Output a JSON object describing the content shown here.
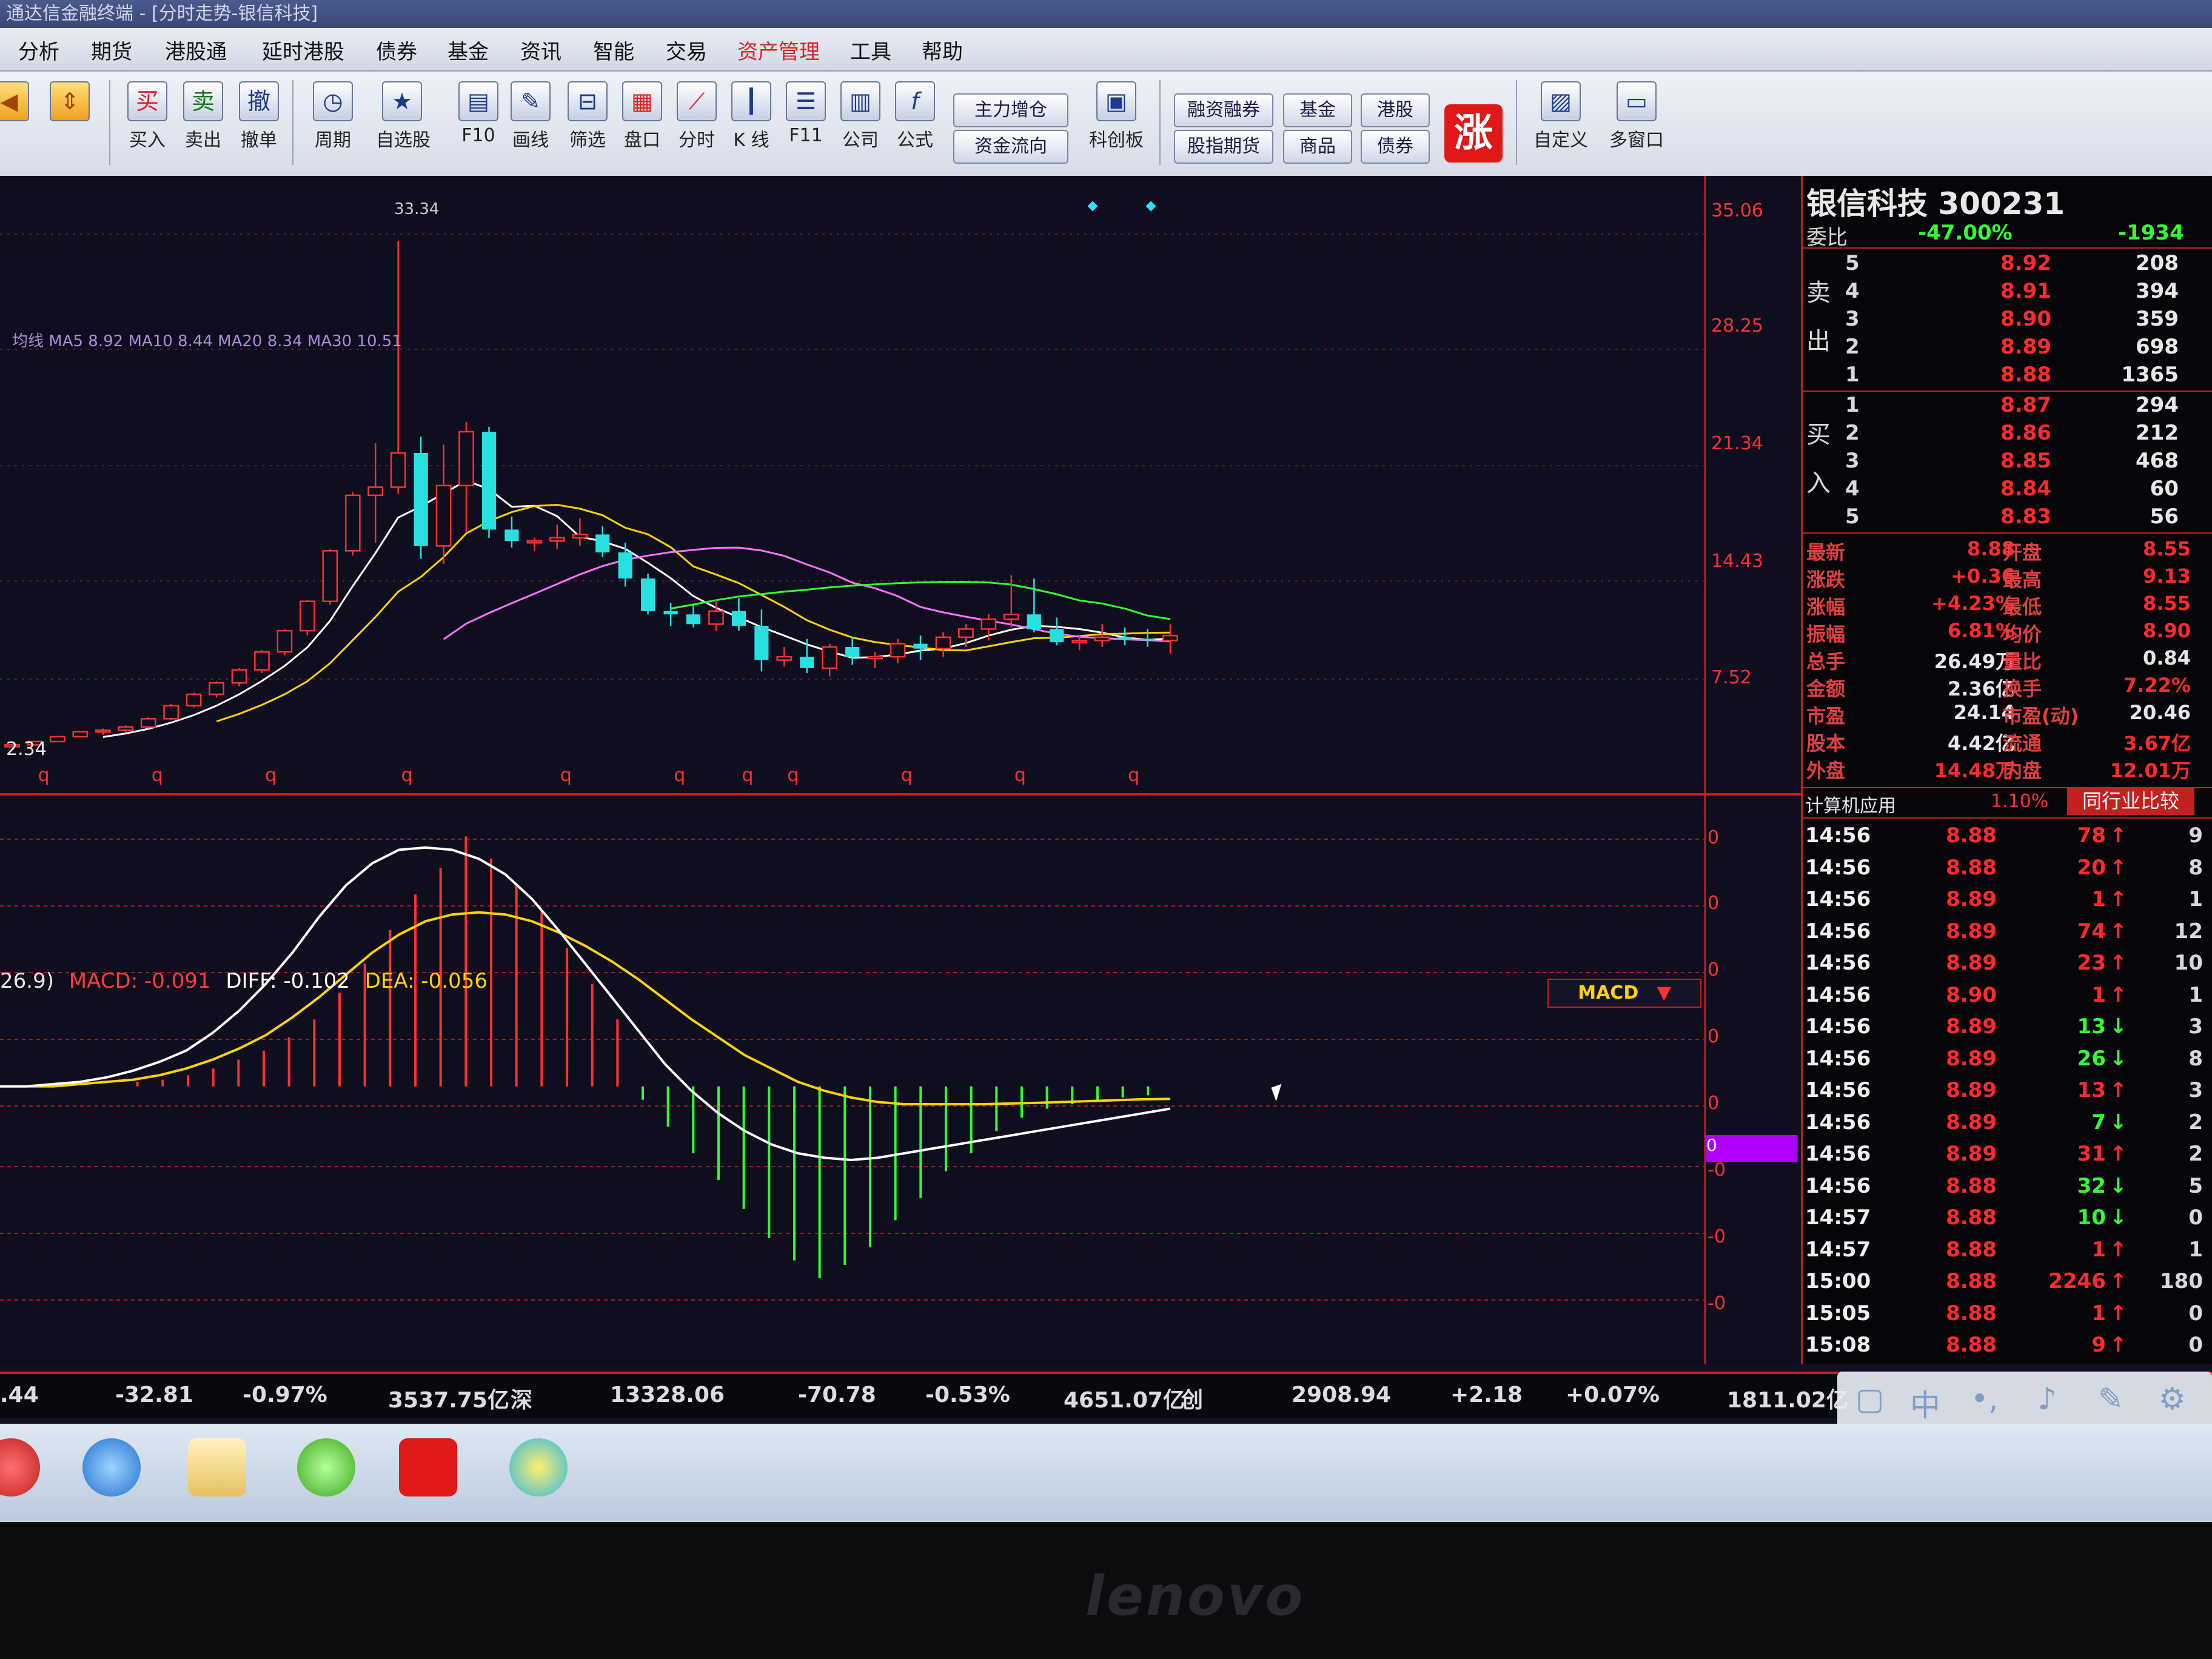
{
  "window": {
    "title": "通达信金融终端 - [分时走势-银信科技]",
    "menu": [
      "分析",
      "期货",
      "港股通",
      "延时港股",
      "债券",
      "基金",
      "资讯",
      "智能",
      "交易",
      "资产管理",
      "工具",
      "帮助"
    ],
    "menu_active": "资产管理"
  },
  "toolbar": {
    "buttons": [
      {
        "icon": "买",
        "label": "买入"
      },
      {
        "icon": "卖",
        "label": "卖出"
      },
      {
        "icon": "撤",
        "label": "撤单"
      },
      {
        "icon": "◷",
        "label": "周期"
      },
      {
        "icon": "★",
        "label": "自选股"
      },
      {
        "icon": "▤",
        "label": "F10"
      },
      {
        "icon": "✎",
        "label": "画线"
      },
      {
        "icon": "⊟",
        "label": "筛选"
      },
      {
        "icon": "▦",
        "label": "盘口"
      },
      {
        "icon": "⟋",
        "label": "分时"
      },
      {
        "icon": "┃",
        "label": "K 线"
      },
      {
        "icon": "☰",
        "label": "F11"
      },
      {
        "icon": "▥",
        "label": "公司"
      },
      {
        "icon": "f",
        "label": "公式"
      }
    ],
    "wide": {
      "zlzc": "主力增仓",
      "zjlx": "资金流向",
      "kcb": "科创板",
      "rzrq": "融资融券",
      "jj": "基金",
      "gg": "港股",
      "gzqh": "股指期货",
      "sp": "商品",
      "zq": "债券",
      "zdy": "自定义",
      "dck": "多窗口"
    },
    "zhang_label": "涨"
  },
  "chart": {
    "ma_legend": "均线 MA5 8.92 MA10 8.44 MA20 8.34 MA30 10.51",
    "price_high_label": "33.34",
    "price_low_label": "2.34",
    "price_ticks": [
      "35.06",
      "28.25",
      "21.34",
      "14.43",
      "7.52"
    ],
    "macd_legend": {
      "params": "26.9)",
      "macd": "MACD: -0.091",
      "diff": "DIFF: -0.102",
      "dea": "DEA: -0.056"
    },
    "macd_select": "MACD",
    "macd_ticks": [
      "0",
      "0",
      "0",
      "0",
      "0",
      "0",
      "-0",
      "-0",
      "-0"
    ],
    "weekly_marks": "q"
  },
  "chart_data": {
    "type": "candlestick",
    "candles": [
      [
        2.4,
        2.4,
        2.4,
        2.4
      ],
      [
        2.4,
        2.6,
        2.4,
        2.6
      ],
      [
        2.6,
        2.9,
        2.6,
        2.9
      ],
      [
        2.9,
        3.2,
        2.9,
        3.2
      ],
      [
        3.2,
        3.4,
        3.0,
        3.3
      ],
      [
        3.3,
        3.6,
        3.2,
        3.5
      ],
      [
        3.5,
        4.1,
        3.4,
        4.0
      ],
      [
        4.0,
        4.9,
        3.9,
        4.8
      ],
      [
        4.8,
        5.6,
        4.7,
        5.5
      ],
      [
        5.5,
        6.3,
        5.3,
        6.2
      ],
      [
        6.2,
        7.1,
        6.0,
        7.0
      ],
      [
        7.0,
        8.2,
        6.8,
        8.1
      ],
      [
        8.1,
        9.5,
        7.9,
        9.4
      ],
      [
        9.4,
        11.3,
        9.1,
        11.2
      ],
      [
        11.2,
        14.4,
        11.0,
        14.3
      ],
      [
        14.3,
        17.9,
        14.0,
        17.7
      ],
      [
        17.7,
        20.9,
        14.8,
        18.2
      ],
      [
        18.2,
        33.3,
        17.8,
        20.3
      ],
      [
        20.3,
        21.3,
        13.8,
        14.6
      ],
      [
        14.6,
        20.8,
        13.5,
        18.3
      ],
      [
        18.3,
        22.2,
        15.4,
        21.6
      ],
      [
        21.6,
        21.9,
        15.1,
        15.6
      ],
      [
        15.6,
        16.4,
        14.5,
        14.9
      ],
      [
        14.9,
        15.1,
        14.3,
        14.9
      ],
      [
        14.9,
        15.9,
        14.4,
        15.1
      ],
      [
        15.1,
        16.3,
        14.6,
        15.3
      ],
      [
        15.3,
        15.8,
        13.9,
        14.2
      ],
      [
        14.2,
        14.8,
        12.1,
        12.6
      ],
      [
        12.6,
        12.9,
        10.4,
        10.6
      ],
      [
        10.6,
        11.1,
        9.7,
        10.4
      ],
      [
        10.4,
        11.0,
        9.6,
        9.8
      ],
      [
        9.8,
        11.3,
        9.4,
        10.6
      ],
      [
        10.6,
        11.4,
        9.4,
        9.7
      ],
      [
        9.7,
        10.7,
        6.9,
        7.6
      ],
      [
        7.6,
        8.4,
        7.2,
        7.8
      ],
      [
        7.8,
        8.9,
        6.8,
        7.1
      ],
      [
        7.1,
        8.6,
        6.6,
        8.4
      ],
      [
        8.4,
        9.0,
        7.3,
        7.8
      ],
      [
        7.8,
        8.1,
        7.1,
        7.8
      ],
      [
        7.8,
        8.9,
        7.4,
        8.6
      ],
      [
        8.6,
        9.1,
        7.6,
        8.3
      ],
      [
        8.3,
        9.3,
        7.8,
        9.0
      ],
      [
        9.0,
        9.8,
        8.4,
        9.5
      ],
      [
        9.5,
        10.4,
        8.8,
        10.1
      ],
      [
        10.1,
        12.8,
        9.6,
        10.4
      ],
      [
        10.4,
        12.6,
        9.3,
        9.5
      ],
      [
        9.5,
        10.2,
        8.5,
        8.7
      ],
      [
        8.7,
        9.1,
        8.2,
        8.8
      ],
      [
        8.8,
        9.8,
        8.4,
        9.0
      ],
      [
        9.0,
        9.6,
        8.5,
        8.9
      ],
      [
        8.9,
        9.5,
        8.4,
        8.8
      ],
      [
        8.8,
        9.8,
        8.0,
        9.1
      ]
    ],
    "ylim": [
      2.34,
      35.06
    ],
    "macd": {
      "hist": [
        0,
        0,
        0,
        0,
        0.02,
        0.03,
        0.05,
        0.08,
        0.12,
        0.16,
        0.22,
        0.3,
        0.42,
        0.55,
        0.7,
        0.86,
        0.98,
        1.12,
        1.02,
        0.9,
        0.78,
        0.62,
        0.46,
        0.3,
        -0.06,
        -0.18,
        -0.3,
        -0.42,
        -0.55,
        -0.68,
        -0.78,
        -0.86,
        -0.8,
        -0.72,
        -0.6,
        -0.5,
        -0.38,
        -0.3,
        -0.2,
        -0.14,
        -0.1,
        -0.08,
        -0.06,
        -0.05,
        -0.04
      ],
      "diff": [
        0,
        0,
        0.01,
        0.02,
        0.04,
        0.07,
        0.11,
        0.16,
        0.24,
        0.34,
        0.46,
        0.6,
        0.76,
        0.9,
        1.0,
        1.06,
        1.07,
        1.06,
        1.02,
        0.95,
        0.84,
        0.7,
        0.55,
        0.4,
        0.25,
        0.1,
        -0.02,
        -0.12,
        -0.2,
        -0.26,
        -0.3,
        -0.32,
        -0.33,
        -0.32,
        -0.3,
        -0.28,
        -0.26,
        -0.24,
        -0.22,
        -0.2,
        -0.18,
        -0.16,
        -0.14,
        -0.12,
        -0.1
      ],
      "dea": [
        0,
        0,
        0,
        0.01,
        0.02,
        0.03,
        0.05,
        0.08,
        0.12,
        0.17,
        0.23,
        0.31,
        0.4,
        0.5,
        0.6,
        0.68,
        0.74,
        0.77,
        0.78,
        0.77,
        0.74,
        0.69,
        0.63,
        0.56,
        0.48,
        0.39,
        0.3,
        0.22,
        0.14,
        0.08,
        0.02,
        -0.02,
        -0.05,
        -0.07,
        -0.08,
        -0.08,
        -0.08,
        -0.08,
        -0.077,
        -0.074,
        -0.07,
        -0.066,
        -0.062,
        -0.058,
        -0.056
      ],
      "ylim": [
        -1.3,
        1.2
      ]
    }
  },
  "panel": {
    "stock_name": "银信科技 300231",
    "ratio_label": "委比",
    "ratio": "-47.00%",
    "ratio_diff": "-1934",
    "sell": [
      {
        "level": "5",
        "price": "8.92",
        "vol": "208"
      },
      {
        "level": "4",
        "price": "8.91",
        "vol": "394"
      },
      {
        "level": "3",
        "price": "8.90",
        "vol": "359"
      },
      {
        "level": "2",
        "price": "8.89",
        "vol": "698"
      },
      {
        "level": "1",
        "price": "8.88",
        "vol": "1365"
      }
    ],
    "buy": [
      {
        "level": "1",
        "price": "8.87",
        "vol": "294"
      },
      {
        "level": "2",
        "price": "8.86",
        "vol": "212"
      },
      {
        "level": "3",
        "price": "8.85",
        "vol": "468"
      },
      {
        "level": "4",
        "price": "8.84",
        "vol": "60"
      },
      {
        "level": "5",
        "price": "8.83",
        "vol": "56"
      }
    ],
    "sell_side": [
      "卖",
      "出"
    ],
    "buy_side": [
      "买",
      "入"
    ],
    "quote": [
      {
        "l1": "最新",
        "v1": "8.88",
        "l2": "开盘",
        "v2": "8.55"
      },
      {
        "l1": "涨跌",
        "v1": "+0.36",
        "l2": "最高",
        "v2": "9.13"
      },
      {
        "l1": "涨幅",
        "v1": "+4.23%",
        "l2": "最低",
        "v2": "8.55"
      },
      {
        "l1": "振幅",
        "v1": "6.81%",
        "l2": "均价",
        "v2": "8.90"
      },
      {
        "l1": "总手",
        "v1": "26.49万",
        "l2": "量比",
        "v2": "0.84"
      },
      {
        "l1": "金额",
        "v1": "2.36亿",
        "l2": "换手",
        "v2": "7.22%"
      },
      {
        "l1": "市盈",
        "v1": "24.14",
        "l2": "市盈(动)",
        "v2": "20.46"
      },
      {
        "l1": "股本",
        "v1": "4.42亿",
        "l2": "流通",
        "v2": "3.67亿"
      },
      {
        "l1": "外盘",
        "v1": "14.48万",
        "l2": "内盘",
        "v2": "12.01万"
      }
    ],
    "industry": "计算机应用",
    "industry_pct": "1.10%",
    "industry_btn": "同行业比较",
    "ticks": [
      {
        "t": "14:56",
        "p": "8.88",
        "v": "78",
        "d": "up",
        "x": "9"
      },
      {
        "t": "14:56",
        "p": "8.88",
        "v": "20",
        "d": "up",
        "x": "8"
      },
      {
        "t": "14:56",
        "p": "8.89",
        "v": "1",
        "d": "up",
        "x": "1"
      },
      {
        "t": "14:56",
        "p": "8.89",
        "v": "74",
        "d": "up",
        "x": "12"
      },
      {
        "t": "14:56",
        "p": "8.89",
        "v": "23",
        "d": "up",
        "x": "10"
      },
      {
        "t": "14:56",
        "p": "8.90",
        "v": "1",
        "d": "up",
        "x": "1"
      },
      {
        "t": "14:56",
        "p": "8.89",
        "v": "13",
        "d": "down",
        "x": "3"
      },
      {
        "t": "14:56",
        "p": "8.89",
        "v": "26",
        "d": "down",
        "x": "8"
      },
      {
        "t": "14:56",
        "p": "8.89",
        "v": "13",
        "d": "up",
        "x": "3"
      },
      {
        "t": "14:56",
        "p": "8.89",
        "v": "7",
        "d": "down",
        "x": "2"
      },
      {
        "t": "14:56",
        "p": "8.89",
        "v": "31",
        "d": "up",
        "x": "2"
      },
      {
        "t": "14:56",
        "p": "8.88",
        "v": "32",
        "d": "down",
        "x": "5"
      },
      {
        "t": "14:57",
        "p": "8.88",
        "v": "10",
        "d": "down",
        "x": "0"
      },
      {
        "t": "14:57",
        "p": "8.88",
        "v": "1",
        "d": "up",
        "x": "1"
      },
      {
        "t": "15:00",
        "p": "8.88",
        "v": "2246",
        "d": "up",
        "x": "180"
      },
      {
        "t": "15:05",
        "p": "8.88",
        "v": "1",
        "d": "up",
        "x": "0"
      },
      {
        "t": "15:08",
        "p": "8.88",
        "v": "9",
        "d": "up",
        "x": "0"
      }
    ]
  },
  "status": {
    "items": [
      {
        "text": ".44",
        "color": "#ffd700"
      },
      {
        "text": "-32.81",
        "color": "#30ff30"
      },
      {
        "text": "-0.97%",
        "color": "#30ff30"
      },
      {
        "text": "3537.75亿",
        "color": "#ffd700"
      },
      {
        "text": "深",
        "color": "#e8e8e8"
      },
      {
        "text": "13328.06",
        "color": "#30ff30"
      },
      {
        "text": "-70.78",
        "color": "#30ff30"
      },
      {
        "text": "-0.53%",
        "color": "#30ff30"
      },
      {
        "text": "4651.07亿",
        "color": "#ffd700"
      },
      {
        "text": "创",
        "color": "#e8e8e8"
      },
      {
        "text": "2908.94",
        "color": "#ff4040"
      },
      {
        "text": "+2.18",
        "color": "#ff4040"
      },
      {
        "text": "+0.07%",
        "color": "#ff4040"
      },
      {
        "text": "1811.02亿",
        "color": "#ffd700"
      }
    ]
  },
  "brand": "lenovo"
}
